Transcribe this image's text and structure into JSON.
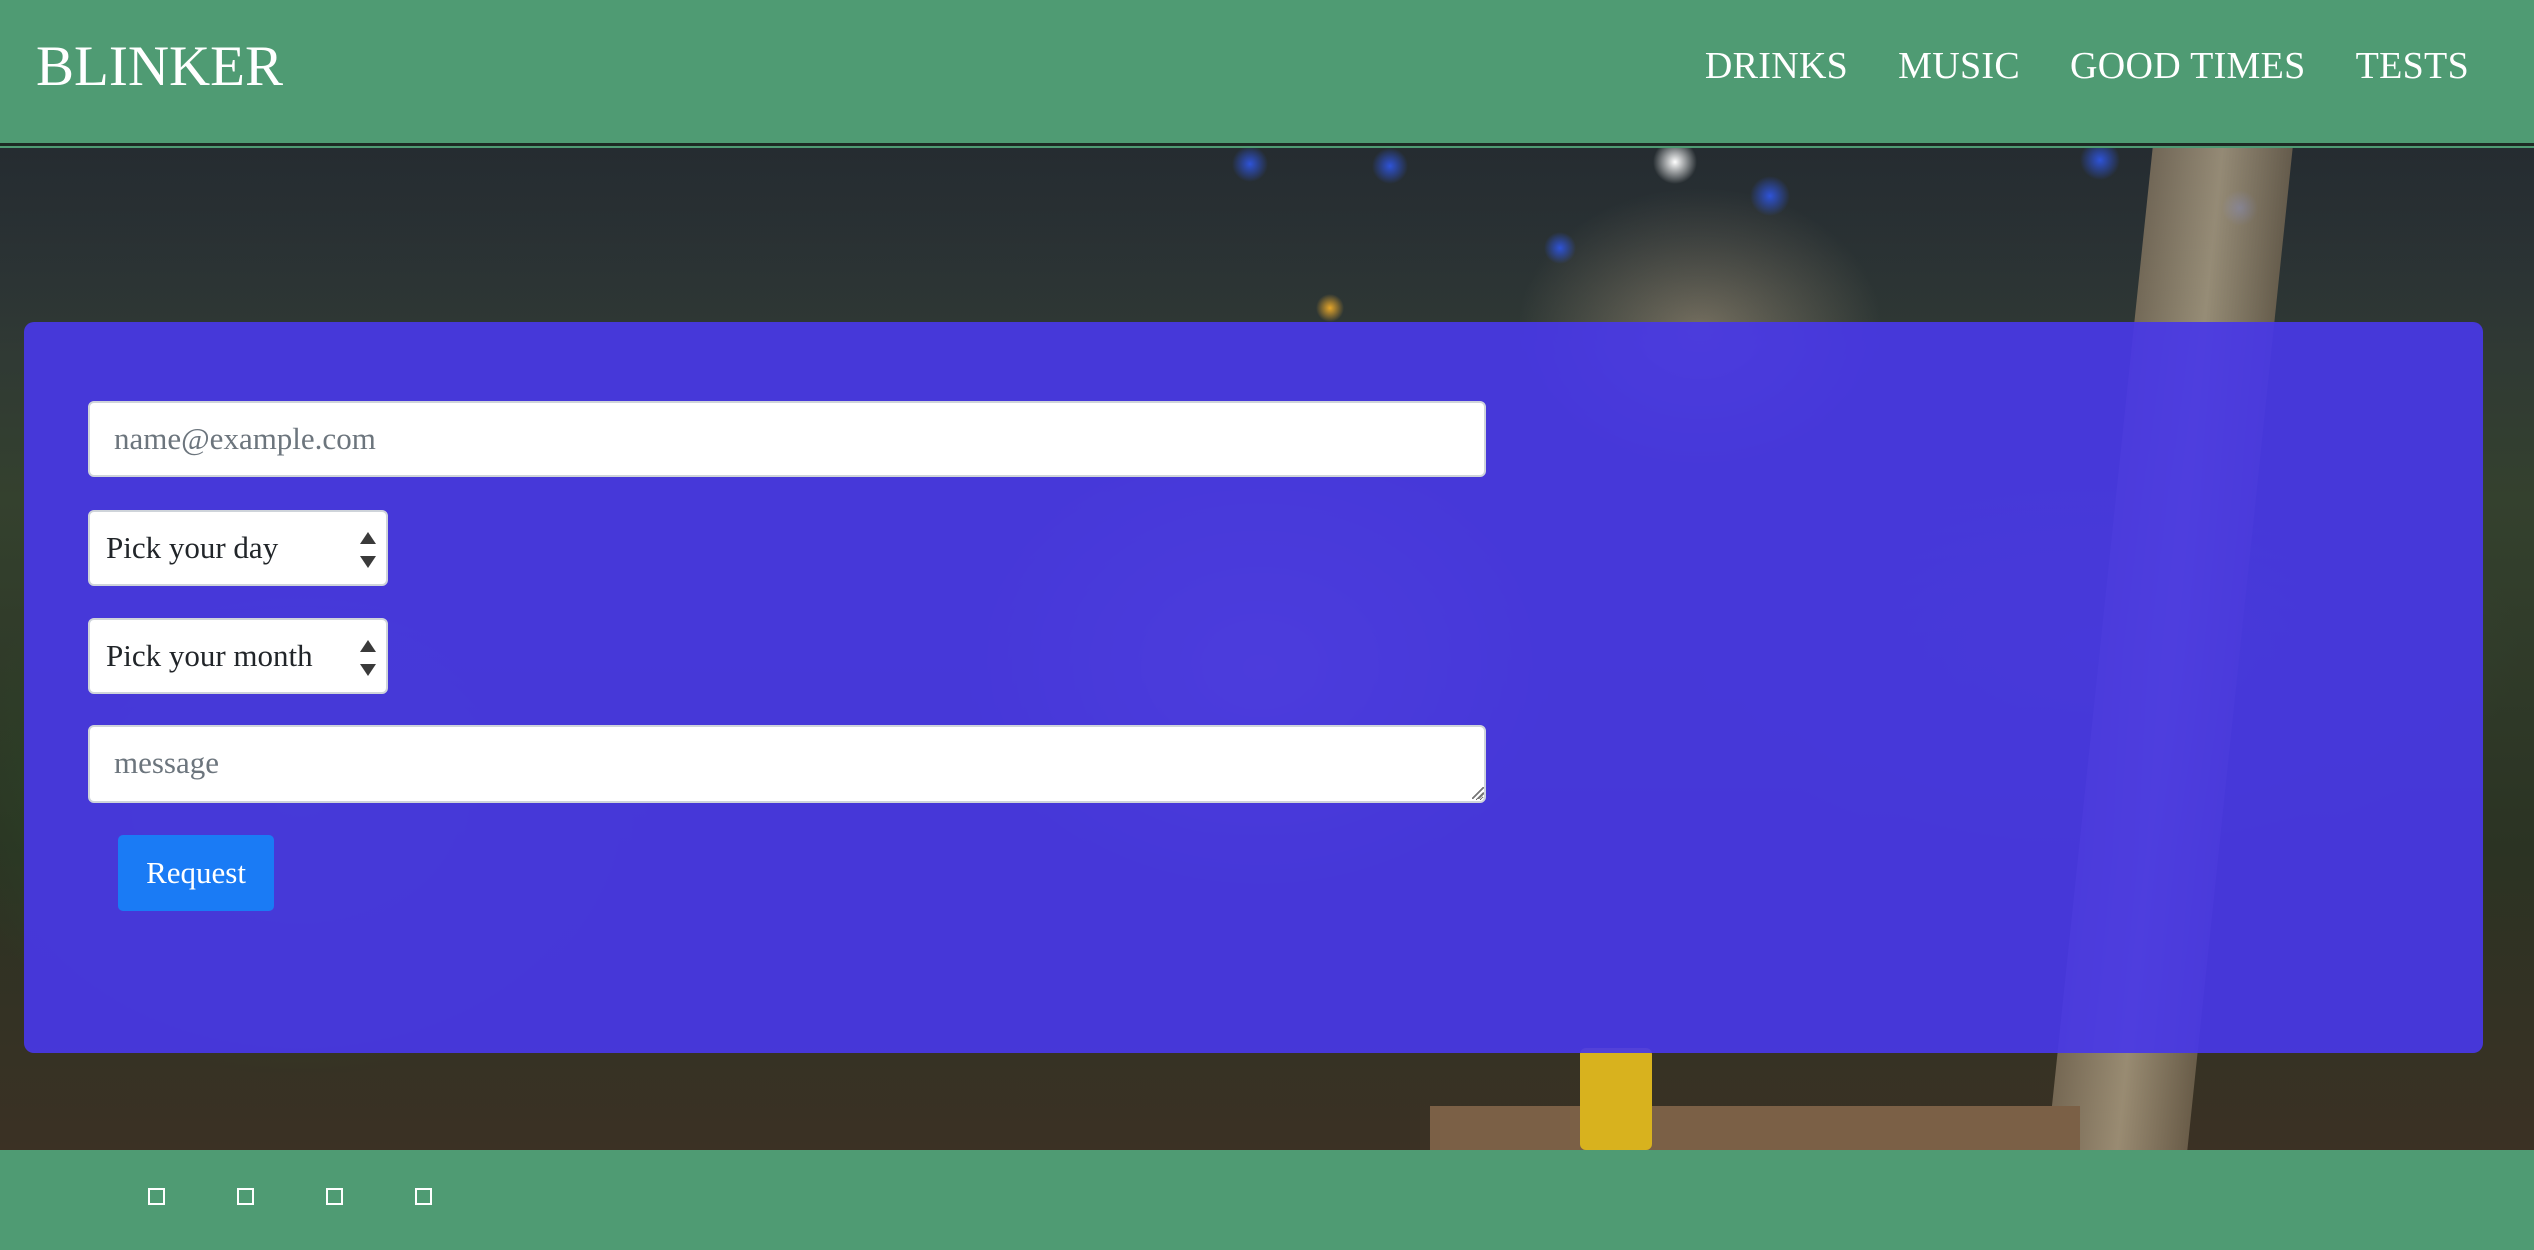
{
  "brand": "BLINKER",
  "nav": {
    "items": [
      {
        "label": "DRINKS"
      },
      {
        "label": "MUSIC"
      },
      {
        "label": "GOOD TIMES"
      },
      {
        "label": "TESTS"
      }
    ]
  },
  "form": {
    "email_placeholder": "name@example.com",
    "day_select_value": "Pick your day",
    "month_select_value": "Pick your month",
    "message_placeholder": "message",
    "submit_label": "Request"
  },
  "footer": {
    "icons": [
      "social-icon-1",
      "social-icon-2",
      "social-icon-3",
      "social-icon-4"
    ]
  },
  "colors": {
    "navbar": "#4f9b73",
    "form_overlay": "#4838e6",
    "button": "#1a7bf5"
  }
}
